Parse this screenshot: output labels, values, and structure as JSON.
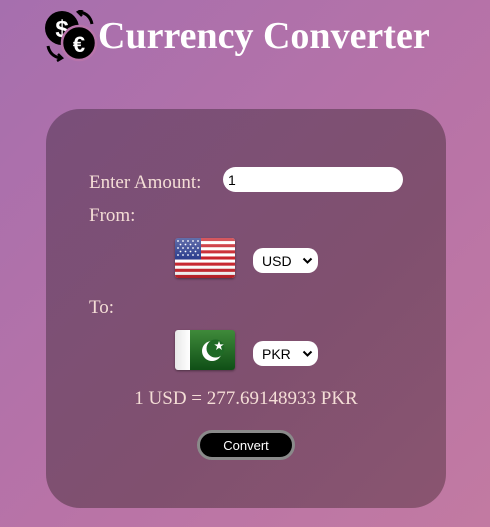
{
  "header": {
    "title": "Currency Converter",
    "logo_icon": "currency-exchange-icon"
  },
  "form": {
    "amount_label": "Enter Amount:",
    "amount_value": "1",
    "from_label": "From:",
    "from_currency": "USD",
    "from_flag_icon": "us-flag-icon",
    "to_label": "To:",
    "to_currency": "PKR",
    "to_flag_icon": "pk-flag-icon",
    "result_text": "1 USD = 277.69148933 PKR",
    "convert_label": "Convert"
  },
  "colors": {
    "background_start": "#a66fae",
    "background_end": "#c27aa2",
    "card": "#7d5075",
    "label_text": "#f4ddd6",
    "button": "#000000"
  }
}
